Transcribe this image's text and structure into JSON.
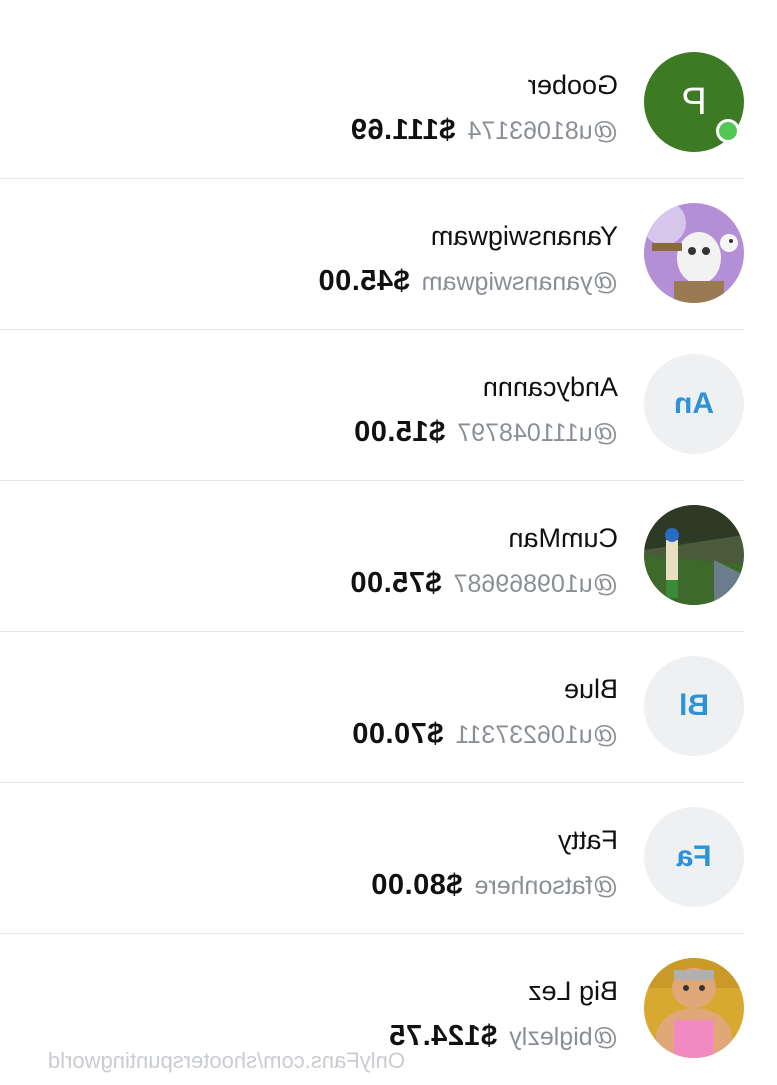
{
  "subscribers": [
    {
      "name": "Goober",
      "handle": "@u81063174",
      "amount": "$111.69",
      "avatar": {
        "type": "letter",
        "text": "P",
        "color": "#3d7a24"
      },
      "online": true
    },
    {
      "name": "Yananswigwam",
      "handle": "@yananswigwam",
      "amount": "$45.00",
      "avatar": {
        "type": "photo",
        "icon": "purple-cartoon-photo"
      },
      "online": false
    },
    {
      "name": "Andycannn",
      "handle": "@u111048797",
      "amount": "$15.00",
      "avatar": {
        "type": "initials",
        "text": "An"
      },
      "online": false
    },
    {
      "name": "CumMan",
      "handle": "@u109869687",
      "amount": "$75.00",
      "avatar": {
        "type": "photo",
        "icon": "game-scene-photo"
      },
      "online": false
    },
    {
      "name": "Blue",
      "handle": "@u106237311",
      "amount": "$70.00",
      "avatar": {
        "type": "initials",
        "text": "Bl"
      },
      "online": false
    },
    {
      "name": "Fatty",
      "handle": "@fatsonhere",
      "amount": "$80.00",
      "avatar": {
        "type": "initials",
        "text": "Fa"
      },
      "online": false
    },
    {
      "name": "Big Lez",
      "handle": "@biglezly",
      "amount": "$124.75",
      "avatar": {
        "type": "photo",
        "icon": "cartoon-character-photo"
      },
      "online": false
    }
  ],
  "watermark": "OnlyFans.com/shooterspuntingworld",
  "colors": {
    "accent": "#2c93d6",
    "online": "#53c756",
    "handle": "#8a8f96",
    "divider": "#e4e6e8"
  }
}
